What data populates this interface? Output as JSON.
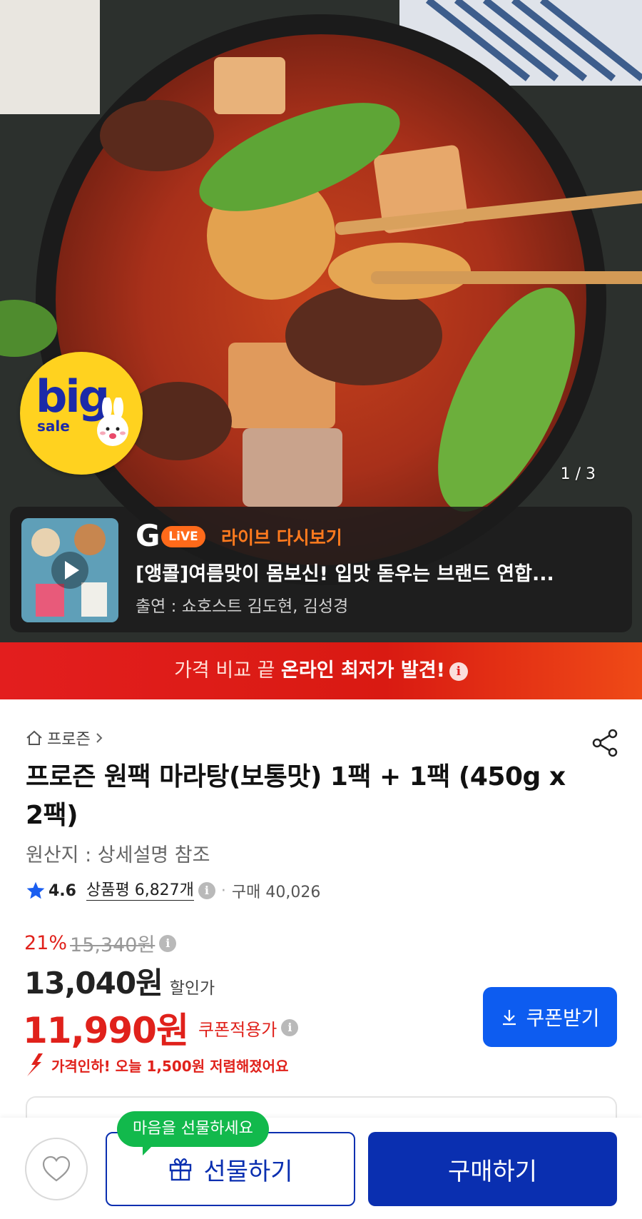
{
  "hero": {
    "badge_big": "big",
    "badge_sale": "sale",
    "page_indicator": "1 / 3"
  },
  "live": {
    "logo_g": "G",
    "logo_live": "LiVE",
    "label": "라이브 다시보기",
    "title": "[앵콜]여름맞이 몸보신! 입맛 돋우는 브랜드 연합...",
    "cast": "출연 : 쇼호스트 김도현, 김성경"
  },
  "promo": {
    "text_light": "가격 비교 끝 ",
    "text_bold": "온라인 최저가 발견!",
    "info_glyph": "i"
  },
  "product": {
    "breadcrumb": "프로즌",
    "title": "프로즌 원팩 마라탕(보통맛) 1팩 + 1팩 (450g x 2팩)",
    "origin": "원산지 : 상세설명 참조",
    "rating": "4.6",
    "reviews": "상품평 6,827개",
    "purchase_count": "구매 40,026"
  },
  "price": {
    "discount": "21%",
    "original": "15,340원",
    "sale": "13,040원",
    "sale_label": "할인가",
    "coupon_price": "11,990원",
    "coupon_label": "쿠폰적용가",
    "coupon_button": "쿠폰받기",
    "price_drop": "가격인하! 오늘 1,500원 저렴해졌어요"
  },
  "bottom": {
    "tooltip": "마음을 선물하세요",
    "gift_button": "선물하기",
    "buy_button": "구매하기"
  },
  "colors": {
    "accent_red": "#e0211b",
    "brand_blue": "#0a2fb0",
    "coupon_blue": "#0d5cf0",
    "live_orange": "#ff6a1a",
    "tooltip_green": "#12b94c"
  }
}
